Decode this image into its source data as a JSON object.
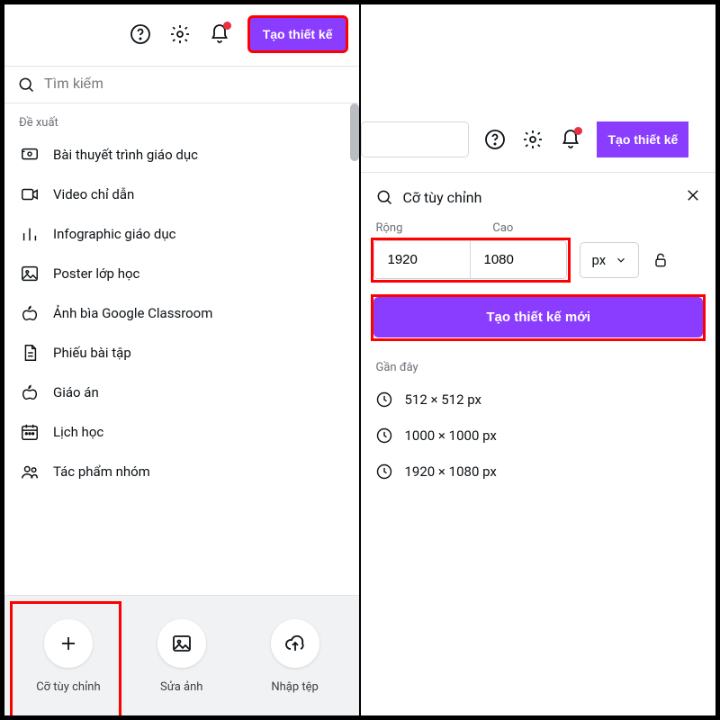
{
  "left": {
    "header": {
      "create_label": "Tạo thiết kế"
    },
    "search_placeholder": "Tìm kiếm",
    "suggested_label": "Đề xuất",
    "items": [
      {
        "label": "Bài thuyết trình giáo dục"
      },
      {
        "label": "Video chỉ dẫn"
      },
      {
        "label": "Infographic giáo dục"
      },
      {
        "label": "Poster lớp học"
      },
      {
        "label": "Ảnh bìa Google Classroom"
      },
      {
        "label": "Phiếu bài tập"
      },
      {
        "label": "Giáo án"
      },
      {
        "label": "Lịch học"
      },
      {
        "label": "Tác phẩm nhóm"
      }
    ],
    "footer": {
      "custom_size": "Cỡ tùy chỉnh",
      "edit_photo": "Sửa ảnh",
      "import": "Nhập tệp"
    }
  },
  "right": {
    "header": {
      "create_label": "Tạo thiết kế"
    },
    "search_value": "Cỡ tùy chỉnh",
    "width_label": "Rộng",
    "height_label": "Cao",
    "width_value": "1920",
    "height_value": "1080",
    "unit": "px",
    "create_new_label": "Tạo thiết kế mới",
    "recent_label": "Gần đây",
    "recent": [
      {
        "label": "512 × 512 px"
      },
      {
        "label": "1000 × 1000 px"
      },
      {
        "label": "1920 × 1080 px"
      }
    ]
  }
}
